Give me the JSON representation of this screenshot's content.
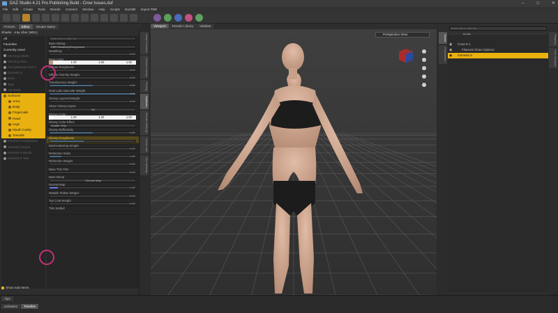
{
  "window": {
    "title": "DAZ Studio 4.21 Pro Publishing Build - Crow Issues.duf"
  },
  "menu": [
    "File",
    "Edit",
    "Create",
    "Tools",
    "Render",
    "Connect",
    "Window",
    "Help",
    "Scripts",
    "Daz3dlt",
    "Import PBR"
  ],
  "left": {
    "tabs": [
      "Presets",
      "Editor",
      "Shader Baker"
    ],
    "shader_label": "Shader - Iray Uber (MDL)",
    "tree_top": [
      "All",
      "Favorites",
      "Currently Used"
    ],
    "tree_items": [
      {
        "label": "G8 Onyx Mesh",
        "state": "dim"
      },
      {
        "label": "G8 Onyx Bun",
        "state": "dim"
      },
      {
        "label": "G8 Eyebrows Hair 1",
        "state": "dim"
      },
      {
        "label": "Genesis 9",
        "state": "dim"
      },
      {
        "label": "Eyes",
        "state": "dim"
      },
      {
        "label": "Tear",
        "state": "dim"
      },
      {
        "label": "G9 Teeth",
        "state": "dim"
      },
      {
        "label": "Surfaces",
        "state": "sel"
      },
      {
        "label": "Arms",
        "state": "sel"
      },
      {
        "label": "Body",
        "state": "sel"
      },
      {
        "label": "Fingernails",
        "state": "sel"
      },
      {
        "label": "Head",
        "state": "sel"
      },
      {
        "label": "Legs",
        "state": "sel"
      },
      {
        "label": "Mouth Cavity",
        "state": "sel"
      },
      {
        "label": "Toenails",
        "state": "sel"
      },
      {
        "label": "Genesis 9 Eyelashes",
        "state": "dim"
      },
      {
        "label": "Genesis 9 Eyes",
        "state": "dim"
      },
      {
        "label": "Genesis 9 Mouth",
        "state": "dim"
      },
      {
        "label": "Genesis 9 Tear",
        "state": "dim"
      }
    ],
    "show_sub_items": "Show Sub Items",
    "props": {
      "search_placeholder": "Enter text to filter by...",
      "base_mixing_label": "Base Mixing",
      "base_mixing_value": "PBR Metallicity/Roughness",
      "metallicity": "Metallicity",
      "metallicity_val": "0.00",
      "base_color": "Base Color",
      "rgb": [
        "1.00",
        "1.00",
        "1.00"
      ],
      "diffuse_roughness": "Diffuse Roughness",
      "diffuse_roughness_val": "0.00",
      "diffuse_overlay_weight": "Diffuse Overlay Weight",
      "diffuse_overlay_weight_val": "0.00",
      "translucency_weight": "Translucency Weight",
      "translucency_weight_val": "0.50",
      "dual_lobe": "Dual Lobe Specular Weight",
      "dual_lobe_val": "1.00",
      "glossy_layered_weight": "Glossy Layered Weight",
      "glossy_layered_weight_val": "0.00",
      "share_glossy": "Share Glossy Inputs",
      "share_glossy_val": "On",
      "glossy_color": "Glossy Color",
      "glossy_rgb": [
        "1.00",
        "1.00",
        "1.00"
      ],
      "glossy_color_effect": "Glossy Color Effect",
      "glossy_color_effect_val": "Scatter Only",
      "glossy_reflectivity": "Glossy Reflectivity",
      "glossy_reflectivity_val": "0.50",
      "glossy_roughness": "Glossy Roughness",
      "backscattering_weight": "Backscattering Weight",
      "backscattering_weight_val": "0.00",
      "refraction_index": "Refraction Index",
      "refraction_index_val": "1.40",
      "refraction_weight": "Refraction Weight",
      "refraction_weight_val": "0.00",
      "base_thin_film": "Base Thin Film",
      "base_thin_film_val": "0.00",
      "base_bump": "Base Bump",
      "base_bump_val": "Choose Map",
      "normal_map": "Normal Map",
      "normal_map_val": "1.00",
      "metallic_flakes": "Metallic Flakes Weight",
      "metallic_flakes_val": "0.00",
      "top_coat_weight": "Top Coat Weight",
      "top_coat_weight_val": "0.00",
      "thin_walled": "Thin Walled"
    },
    "side_tabs": [
      "Smart Content",
      "Content Library",
      "Posing",
      "Surfaces",
      "Render Settings",
      "Scene Info",
      "Tool Settings"
    ]
  },
  "viewport": {
    "tabs": [
      "Viewport",
      "Render Library",
      "Validate"
    ],
    "camera": "Perspective View"
  },
  "right": {
    "search_placeholder": "Enter text to filter by...",
    "col_node": "Node",
    "nodes": [
      {
        "label": "Crow 8.1",
        "state": "normal"
      },
      {
        "label": "Filament Draw Options",
        "state": "normal"
      },
      {
        "label": "Genesis 9",
        "state": "sel"
      }
    ],
    "tabs": [
      "Tips",
      "Node"
    ],
    "side_tabs": [
      "Scene",
      "Parameters",
      "Shaping",
      "Aux Viewport"
    ]
  },
  "bottom": {
    "tabs": [
      "aniMate2",
      "Timeline"
    ],
    "left_tab": "Tips"
  }
}
